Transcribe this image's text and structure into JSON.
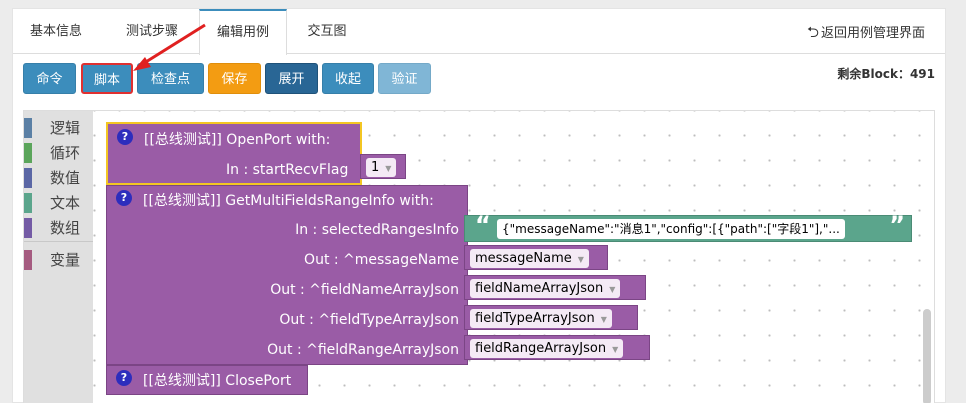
{
  "tabs": [
    {
      "label": "基本信息"
    },
    {
      "label": "测试步骤"
    },
    {
      "label": "编辑用例"
    },
    {
      "label": "交互图"
    }
  ],
  "back_link": {
    "label": "返回用例管理界面"
  },
  "toolbar": {
    "buttons": [
      {
        "label": "命令"
      },
      {
        "label": "脚本"
      },
      {
        "label": "检查点"
      },
      {
        "label": "保存"
      },
      {
        "label": "展开"
      },
      {
        "label": "收起"
      },
      {
        "label": "验证"
      }
    ],
    "remaining": "剩余Block：491"
  },
  "toolbox": {
    "categories": [
      {
        "label": "逻辑",
        "color": "#5b80a5"
      },
      {
        "label": "循环",
        "color": "#5ba55b"
      },
      {
        "label": "数值",
        "color": "#5b67a5"
      },
      {
        "label": "文本",
        "color": "#5ba58c"
      },
      {
        "label": "数组",
        "color": "#745ba5"
      },
      {
        "label": "变量",
        "color": "#a55b80"
      }
    ]
  },
  "blocks": {
    "help": "?",
    "open_port": {
      "title": "[[总线测试]]  OpenPort  with:",
      "input_label": "In : startRecvFlag",
      "input_value": "1"
    },
    "get_multi": {
      "title": "[[总线测试]]  GetMultiFieldsRangeInfo  with:",
      "inputs": [
        {
          "label": "In : selectedRangesInfo",
          "value": "{\"messageName\":\"消息1\",\"config\":[{\"path\":[\"字段1\"],\"..."
        },
        {
          "label": "Out : ^messageName",
          "value": "messageName"
        },
        {
          "label": "Out : ^fieldNameArrayJson",
          "value": "fieldNameArrayJson"
        },
        {
          "label": "Out : ^fieldTypeArrayJson",
          "value": "fieldTypeArrayJson"
        },
        {
          "label": "Out : ^fieldRangeArrayJson",
          "value": "fieldRangeArrayJson"
        }
      ]
    },
    "close_port": {
      "title": "[[总线测试]]  ClosePort"
    }
  },
  "colors": {
    "accent": "#3c8dbc",
    "save": "#f39c12",
    "block_purple": "#9a5ca6",
    "text_block_green": "#5ba58c",
    "highlight_red": "#e03030",
    "selection_yellow": "#f3c623"
  }
}
